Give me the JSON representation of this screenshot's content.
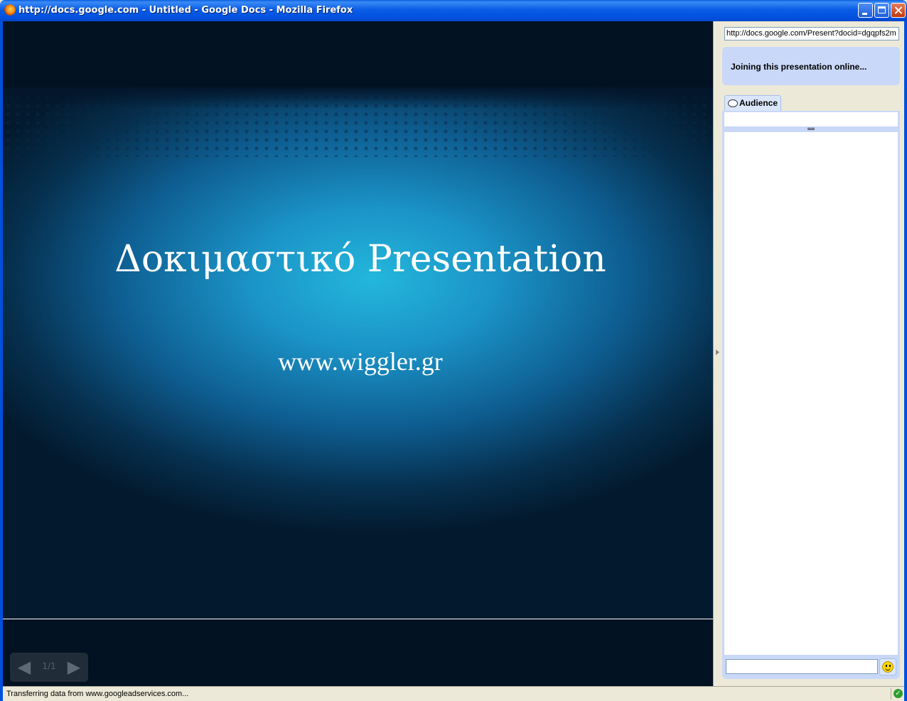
{
  "window": {
    "title": "http://docs.google.com - Untitled - Google Docs - Mozilla Firefox"
  },
  "slide": {
    "title": "Δοκιμαστικό Presentation",
    "subtitle": "www.wiggler.gr",
    "nav": {
      "counter": "1/1",
      "prev_icon": "arrow-left-icon",
      "next_icon": "arrow-right-icon"
    }
  },
  "panel": {
    "url": "http://docs.google.com/Present?docid=dgqpfs2m",
    "status_message": "Joining this presentation online...",
    "tabs": [
      {
        "label": "Audience",
        "icon": "chat-bubble-icon"
      }
    ],
    "chat": {
      "input_value": "",
      "emoticon_icon": "smiley-icon"
    }
  },
  "statusbar": {
    "text": "Transferring data from www.googleadservices.com...",
    "security_icon": "check-circle-icon"
  },
  "colors": {
    "title_bar": "#0050df",
    "slide_glow": "#23b7dc",
    "stage_background": "#021223",
    "panel_accent": "#c9d8f8"
  }
}
